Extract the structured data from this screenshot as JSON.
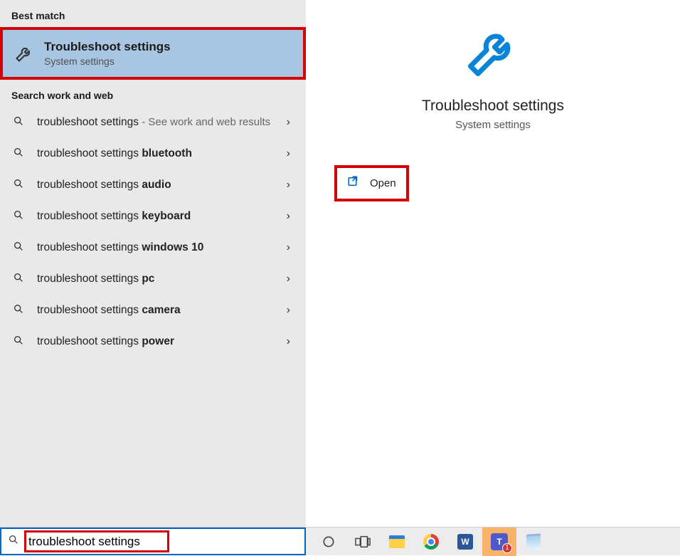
{
  "left": {
    "best_match_header": "Best match",
    "best_match": {
      "title": "Troubleshoot settings",
      "subtitle": "System settings"
    },
    "search_header": "Search work and web",
    "suggestions": [
      {
        "prefix": "troubleshoot settings",
        "bold": "",
        "suffix": " - See work and web results"
      },
      {
        "prefix": "troubleshoot settings ",
        "bold": "bluetooth",
        "suffix": ""
      },
      {
        "prefix": "troubleshoot settings ",
        "bold": "audio",
        "suffix": ""
      },
      {
        "prefix": "troubleshoot settings ",
        "bold": "keyboard",
        "suffix": ""
      },
      {
        "prefix": "troubleshoot settings ",
        "bold": "windows 10",
        "suffix": ""
      },
      {
        "prefix": "troubleshoot settings ",
        "bold": "pc",
        "suffix": ""
      },
      {
        "prefix": "troubleshoot settings ",
        "bold": "camera",
        "suffix": ""
      },
      {
        "prefix": "troubleshoot settings ",
        "bold": "power",
        "suffix": ""
      }
    ]
  },
  "right": {
    "title": "Troubleshoot settings",
    "subtitle": "System settings",
    "open_label": "Open"
  },
  "taskbar": {
    "search_value": "troubleshoot settings",
    "icons": {
      "cortana": "cortana-icon",
      "taskview": "task-view-icon",
      "explorer": "file-explorer-icon",
      "chrome": "chrome-icon",
      "word": "word-icon",
      "teams": "teams-icon",
      "teams_badge": "1",
      "notes": "sticky-notes-icon"
    },
    "labels": {
      "word": "W",
      "teams": "T"
    }
  },
  "colors": {
    "accent": "#0067c0",
    "highlight_bg": "#a8c6e2",
    "annotation": "#d40000"
  }
}
